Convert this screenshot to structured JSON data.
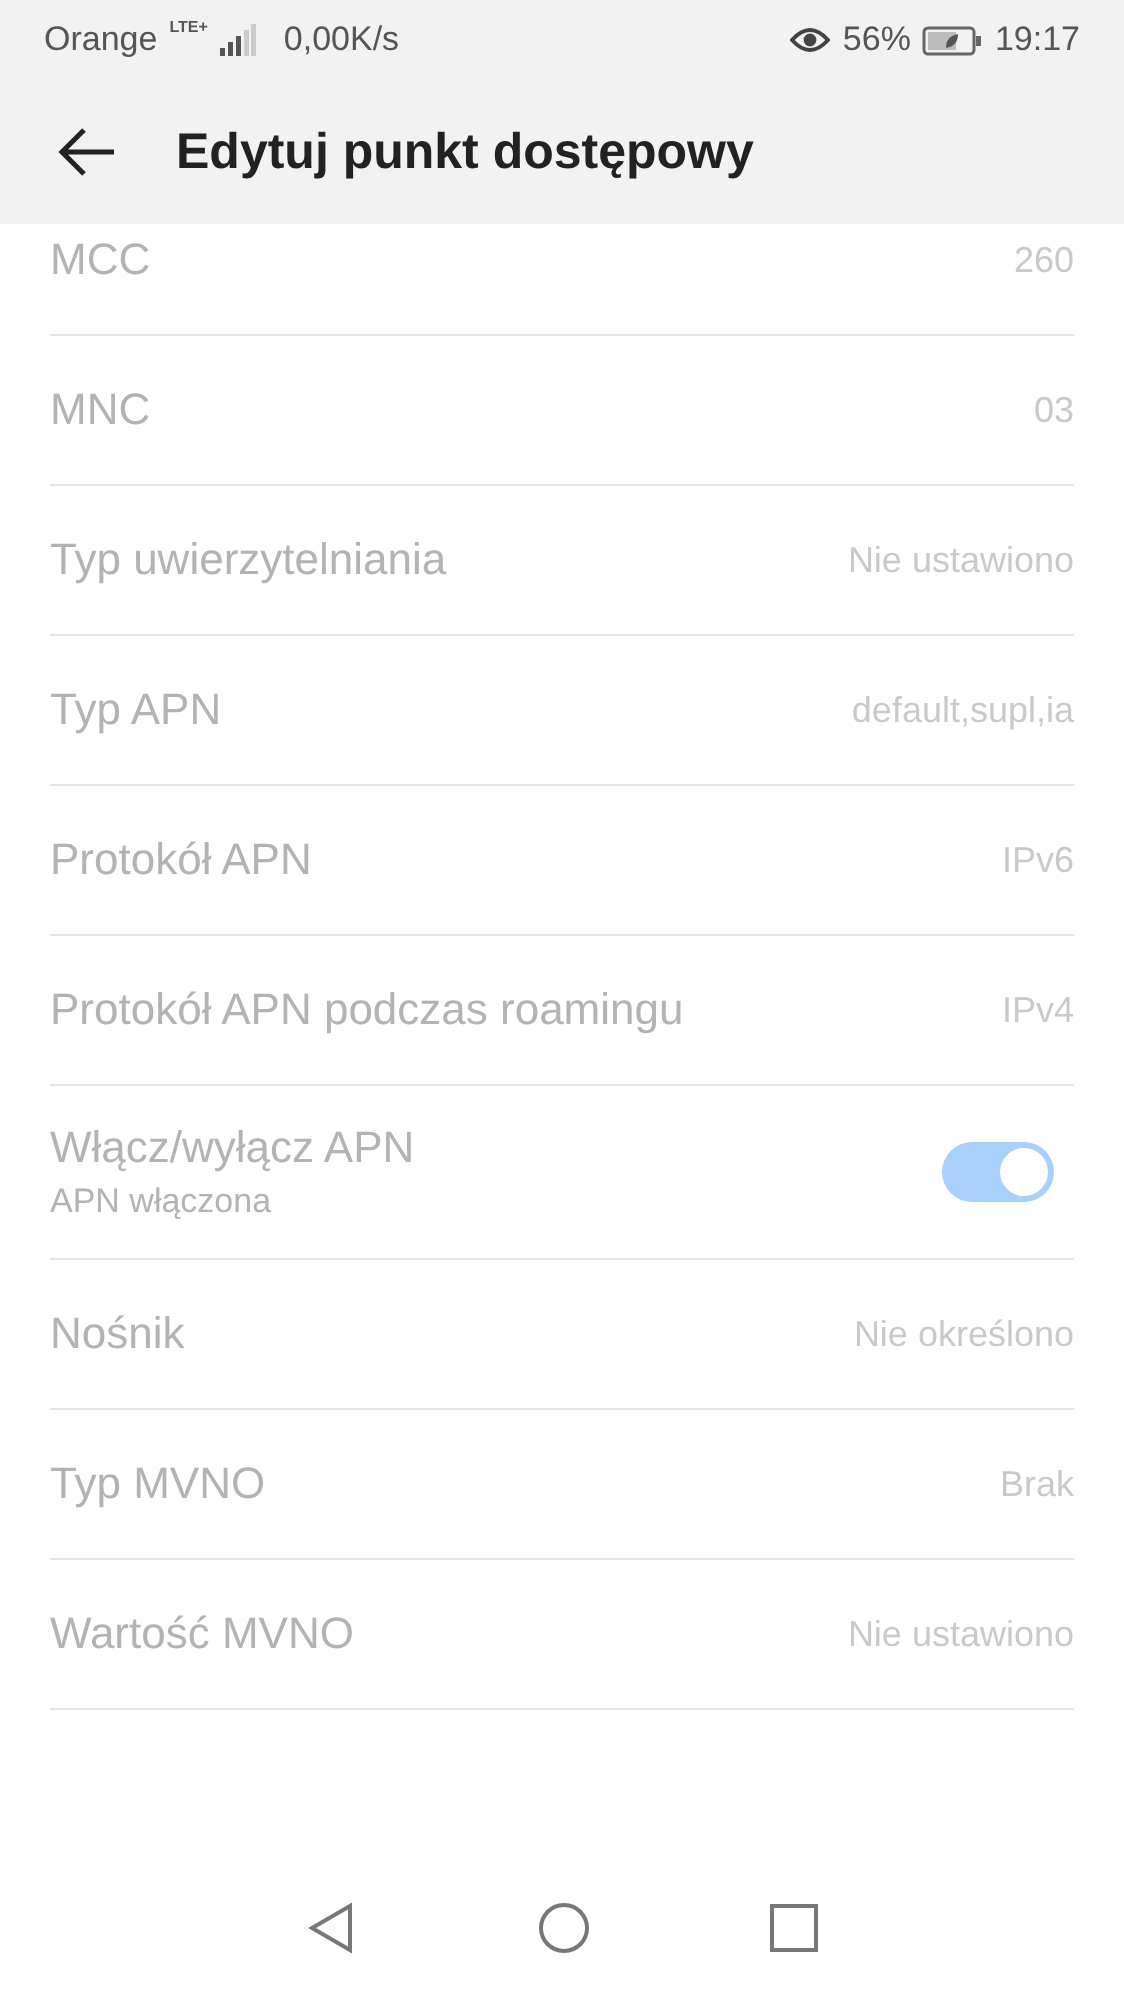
{
  "status_bar": {
    "carrier": "Orange",
    "network": "LTE+",
    "speed": "0,00K/s",
    "battery": "56%",
    "time": "19:17"
  },
  "header": {
    "title": "Edytuj punkt dostępowy"
  },
  "settings": [
    {
      "kind": "value",
      "label": "MCC",
      "value": "260",
      "disabled": true
    },
    {
      "kind": "value",
      "label": "MNC",
      "value": "03",
      "disabled": true
    },
    {
      "kind": "value",
      "label": "Typ uwierzytelniania",
      "value": "Nie ustawiono",
      "disabled": true
    },
    {
      "kind": "value",
      "label": "Typ APN",
      "value": "default,supl,ia",
      "disabled": true
    },
    {
      "kind": "value",
      "label": "Protokół APN",
      "value": "IPv6",
      "disabled": true
    },
    {
      "kind": "value",
      "label": "Protokół APN podczas roamingu",
      "value": "IPv4",
      "disabled": true
    },
    {
      "kind": "toggle",
      "label": "Włącz/wyłącz APN",
      "summary": "APN włączona",
      "on": true,
      "disabled": true
    },
    {
      "kind": "value",
      "label": "Nośnik",
      "value": "Nie określono",
      "disabled": true
    },
    {
      "kind": "value",
      "label": "Typ MVNO",
      "value": "Brak",
      "disabled": true
    },
    {
      "kind": "value",
      "label": "Wartość MVNO",
      "value": "Nie ustawiono",
      "disabled": true
    }
  ]
}
